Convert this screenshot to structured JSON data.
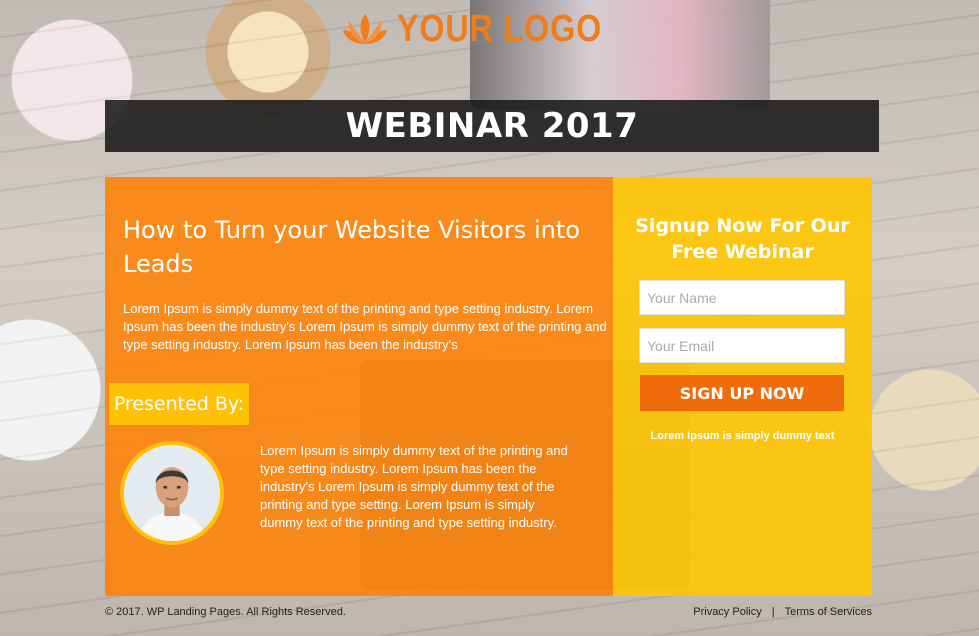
{
  "logo": {
    "text": "YOUR LOGO",
    "color": "#f07d1c"
  },
  "banner": {
    "title": "WEBINAR 2017"
  },
  "main": {
    "headline": "How to Turn your Website Visitors into Leads",
    "intro": "Lorem Ipsum is simply dummy text of the printing and type setting industry. Lorem Ipsum has been the industry's Lorem Ipsum is simply dummy text of the printing and type setting industry. Lorem Ipsum has been the industry's",
    "presented_by": "Presented By:",
    "bio": "Lorem Ipsum is simply dummy text of the printing and type setting industry. Lorem Ipsum has been the industry's Lorem Ipsum is simply dummy text of the printing and type setting. Lorem Ipsum is simply dummy text of the printing and type setting industry."
  },
  "signup": {
    "title": "Signup Now For Our Free Webinar",
    "name_placeholder": "Your Name",
    "email_placeholder": "Your Email",
    "button_label": "SIGN UP NOW",
    "note": "Lorem Ipsum is simply dummy text"
  },
  "footer": {
    "copyright": "© 2017. WP Landing Pages. All Rights Reserved.",
    "privacy": "Privacy Policy",
    "separator": "|",
    "terms": "Terms of Services"
  },
  "colors": {
    "orange_panel": "#ff8000",
    "yellow_panel": "#ffc500",
    "button": "#f06b0c",
    "presented_tag": "#ffc107"
  }
}
